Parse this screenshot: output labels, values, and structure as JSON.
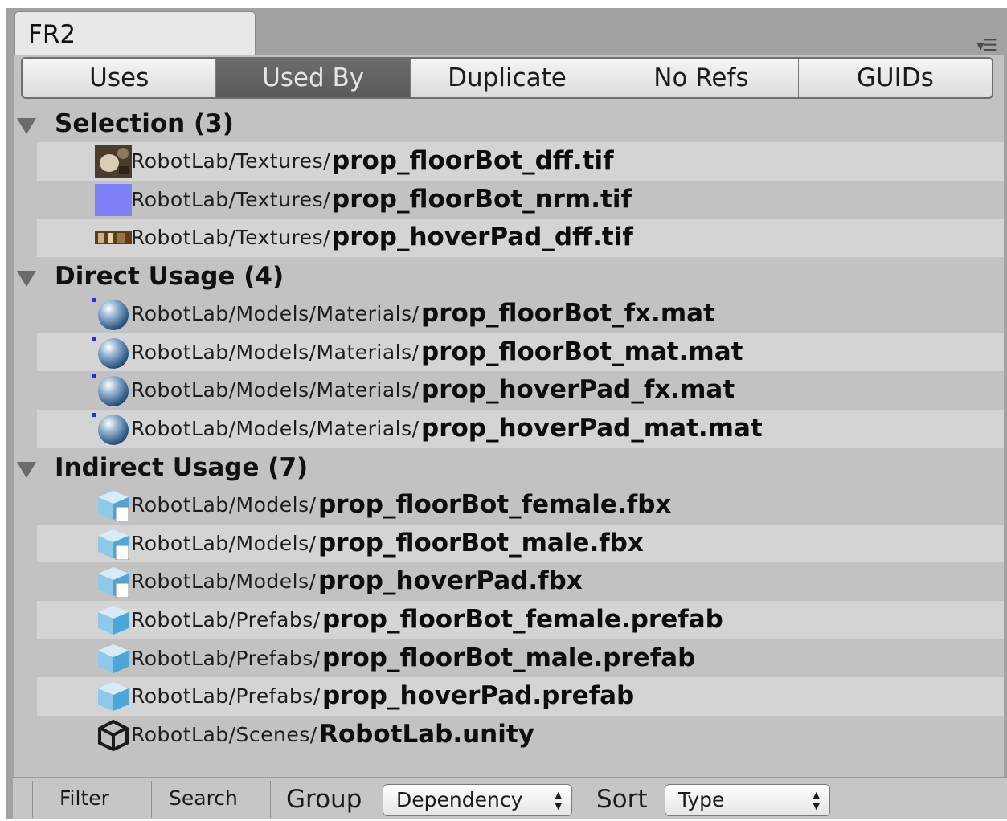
{
  "window": {
    "tab_title": "FR2"
  },
  "tabs": [
    "Uses",
    "Used By",
    "Duplicate",
    "No Refs",
    "GUIDs"
  ],
  "active_tab": "Used By",
  "groups": [
    {
      "label": "Selection (3)",
      "rows": [
        {
          "path": "RobotLab/Textures/",
          "file": "prop_floorBot_dff.tif",
          "icon": "texture-thumbnail-icon"
        },
        {
          "path": "RobotLab/Textures/",
          "file": "prop_floorBot_nrm.tif",
          "icon": "normal-map-thumbnail-icon"
        },
        {
          "path": "RobotLab/Textures/",
          "file": "prop_hoverPad_dff.tif",
          "icon": "texture-thumbnail-icon"
        }
      ]
    },
    {
      "label": "Direct Usage (4)",
      "rows": [
        {
          "path": "RobotLab/Models/Materials/",
          "file": "prop_floorBot_fx.mat",
          "icon": "material-sphere-icon"
        },
        {
          "path": "RobotLab/Models/Materials/",
          "file": "prop_floorBot_mat.mat",
          "icon": "material-sphere-icon"
        },
        {
          "path": "RobotLab/Models/Materials/",
          "file": "prop_hoverPad_fx.mat",
          "icon": "material-sphere-icon"
        },
        {
          "path": "RobotLab/Models/Materials/",
          "file": "prop_hoverPad_mat.mat",
          "icon": "material-sphere-icon"
        }
      ]
    },
    {
      "label": "Indirect Usage (7)",
      "rows": [
        {
          "path": "RobotLab/Models/",
          "file": "prop_floorBot_female.fbx",
          "icon": "model-file-icon"
        },
        {
          "path": "RobotLab/Models/",
          "file": "prop_floorBot_male.fbx",
          "icon": "model-file-icon"
        },
        {
          "path": "RobotLab/Models/",
          "file": "prop_hoverPad.fbx",
          "icon": "model-file-icon"
        },
        {
          "path": "RobotLab/Prefabs/",
          "file": "prop_floorBot_female.prefab",
          "icon": "prefab-cube-icon"
        },
        {
          "path": "RobotLab/Prefabs/",
          "file": "prop_floorBot_male.prefab",
          "icon": "prefab-cube-icon"
        },
        {
          "path": "RobotLab/Prefabs/",
          "file": "prop_hoverPad.prefab",
          "icon": "prefab-cube-icon"
        },
        {
          "path": "RobotLab/Scenes/",
          "file": "RobotLab.unity",
          "icon": "unity-scene-icon"
        }
      ]
    }
  ],
  "bottom": {
    "filter": "Filter",
    "search": "Search",
    "group_label": "Group",
    "group_value": "Dependency",
    "sort_label": "Sort",
    "sort_value": "Type"
  },
  "colors": {
    "accent_dot": "#1a2cff",
    "active_tab": "#636363",
    "panel": "#c2c2c2"
  }
}
